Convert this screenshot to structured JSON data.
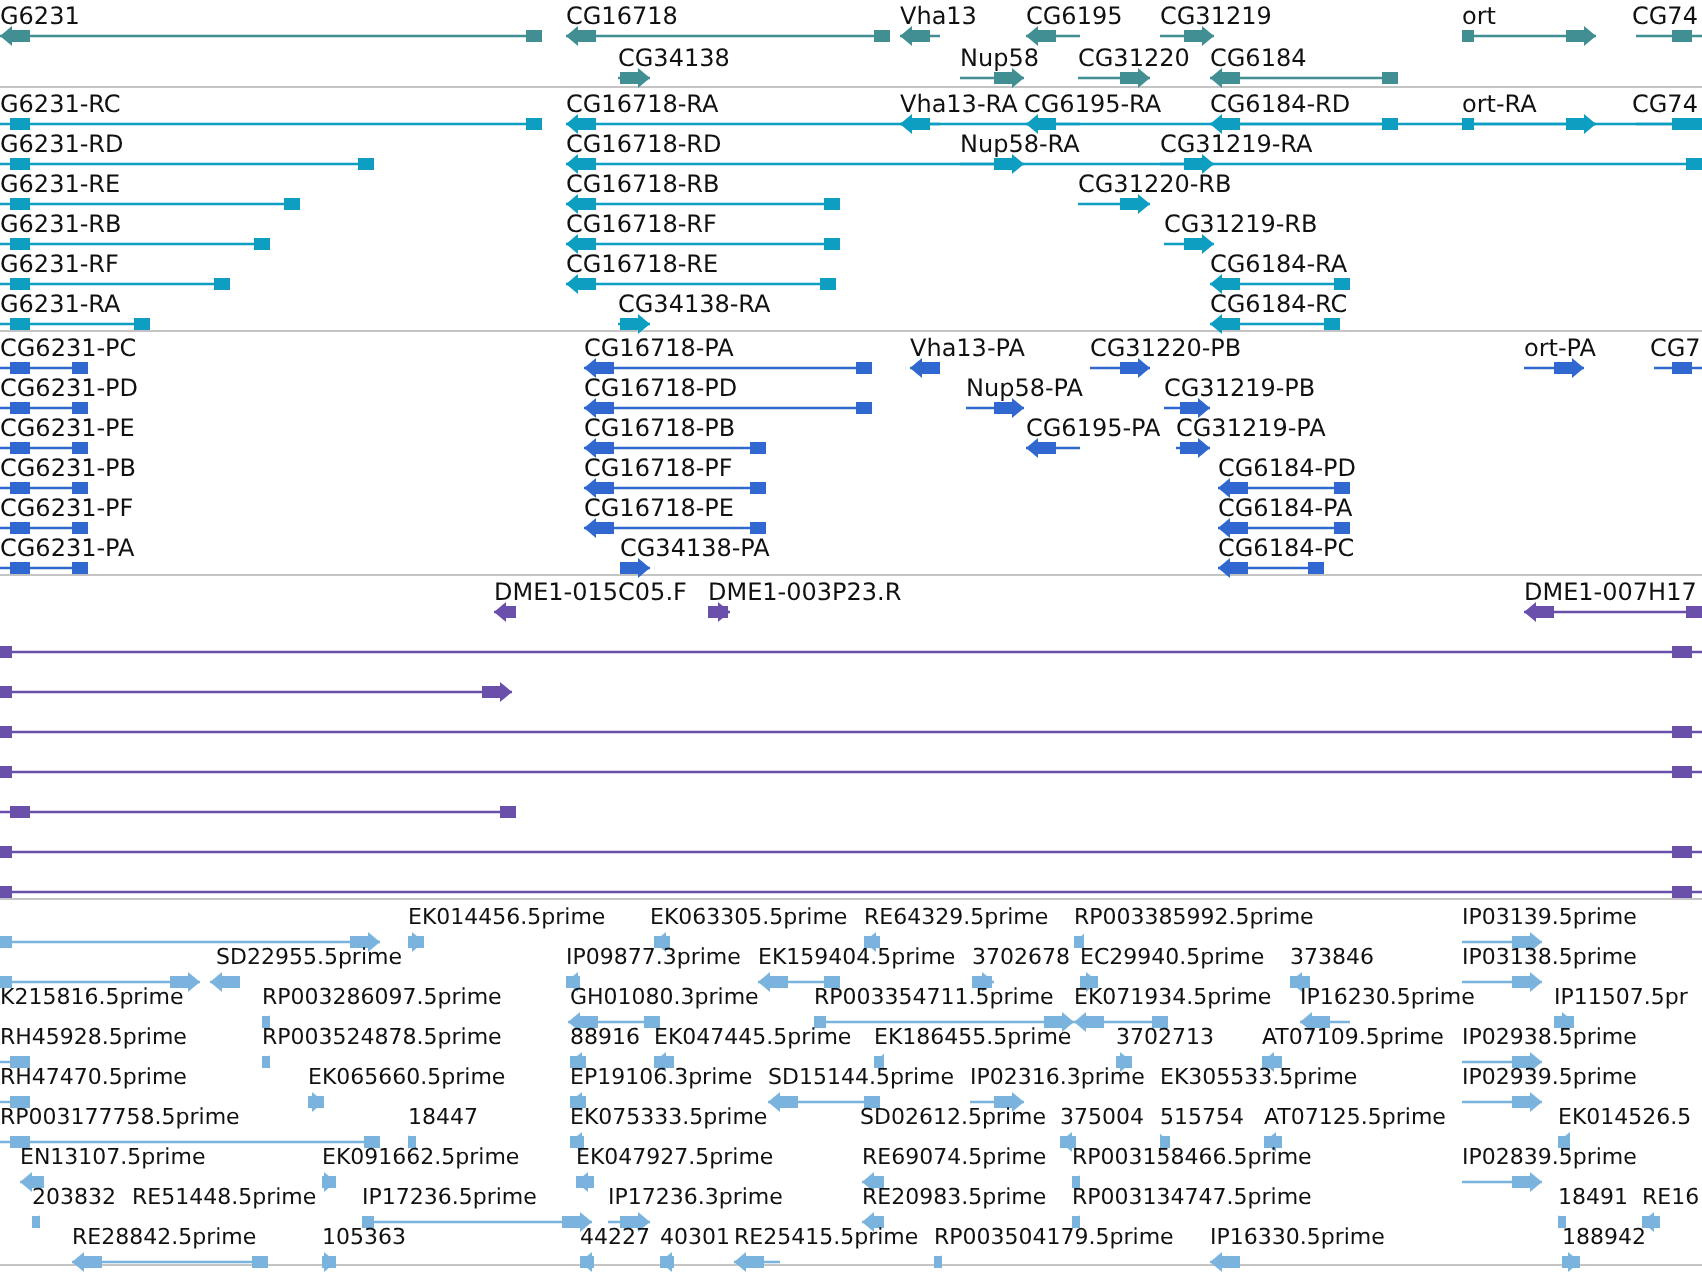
{
  "tracks": [
    {
      "kind": "gene",
      "features": [
        {
          "label": "G6231",
          "reverse": true
        },
        {
          "label": "CG16718",
          "reverse": true
        },
        {
          "label": "Vha13",
          "reverse": true
        },
        {
          "label": "CG6195",
          "reverse": true
        },
        {
          "label": "CG31219",
          "reverse": false
        },
        {
          "label": "ort",
          "reverse": false
        },
        {
          "label": "CG74",
          "reverse": false
        },
        {
          "label": "CG34138",
          "reverse": false
        },
        {
          "label": "Nup58",
          "reverse": false
        },
        {
          "label": "CG31220",
          "reverse": false
        },
        {
          "label": "CG6184",
          "reverse": true
        }
      ]
    },
    {
      "kind": "transcript",
      "features": [
        {
          "label": "G6231-RC",
          "reverse": true
        },
        {
          "label": "CG16718-RA",
          "reverse": true
        },
        {
          "label": "Vha13-RA",
          "reverse": true
        },
        {
          "label": "CG6195-RA",
          "reverse": true
        },
        {
          "label": "CG6184-RD",
          "reverse": true
        },
        {
          "label": "ort-RA",
          "reverse": false
        },
        {
          "label": "CG74",
          "reverse": false
        },
        {
          "label": "G6231-RD",
          "reverse": true
        },
        {
          "label": "CG16718-RD",
          "reverse": true
        },
        {
          "label": "Nup58-RA",
          "reverse": false
        },
        {
          "label": "CG31219-RA",
          "reverse": false
        },
        {
          "label": "G6231-RE",
          "reverse": true
        },
        {
          "label": "CG16718-RB",
          "reverse": true
        },
        {
          "label": "CG31220-RB",
          "reverse": false
        },
        {
          "label": "G6231-RB",
          "reverse": true
        },
        {
          "label": "CG16718-RF",
          "reverse": true
        },
        {
          "label": "CG31219-RB",
          "reverse": false
        },
        {
          "label": "G6231-RF",
          "reverse": true
        },
        {
          "label": "CG16718-RE",
          "reverse": true
        },
        {
          "label": "CG6184-RA",
          "reverse": true
        },
        {
          "label": "G6231-RA",
          "reverse": true
        },
        {
          "label": "CG34138-RA",
          "reverse": false
        },
        {
          "label": "CG6184-RC",
          "reverse": true
        }
      ]
    },
    {
      "kind": "protein",
      "features": [
        {
          "label": "CG6231-PC",
          "reverse": true
        },
        {
          "label": "CG16718-PA",
          "reverse": true
        },
        {
          "label": "Vha13-PA",
          "reverse": true
        },
        {
          "label": "CG31220-PB",
          "reverse": false
        },
        {
          "label": "ort-PA",
          "reverse": false
        },
        {
          "label": "CG7",
          "reverse": false
        },
        {
          "label": "CG6231-PD",
          "reverse": true
        },
        {
          "label": "CG16718-PD",
          "reverse": true
        },
        {
          "label": "Nup58-PA",
          "reverse": false
        },
        {
          "label": "CG31219-PB",
          "reverse": false
        },
        {
          "label": "CG6231-PE",
          "reverse": true
        },
        {
          "label": "CG16718-PB",
          "reverse": true
        },
        {
          "label": "CG6195-PA",
          "reverse": true
        },
        {
          "label": "CG31219-PA",
          "reverse": false
        },
        {
          "label": "CG6231-PB",
          "reverse": true
        },
        {
          "label": "CG16718-PF",
          "reverse": true
        },
        {
          "label": "CG6184-PD",
          "reverse": true
        },
        {
          "label": "CG6231-PF",
          "reverse": true
        },
        {
          "label": "CG16718-PE",
          "reverse": true
        },
        {
          "label": "CG6184-PA",
          "reverse": true
        },
        {
          "label": "CG6231-PA",
          "reverse": true
        },
        {
          "label": "CG34138-PA",
          "reverse": false
        },
        {
          "label": "CG6184-PC",
          "reverse": true
        }
      ]
    },
    {
      "kind": "clone",
      "features": [
        {
          "label": "DME1-015C05.F",
          "reverse": true
        },
        {
          "label": "DME1-003P23.R",
          "reverse": false
        },
        {
          "label": "DME1-007H17",
          "reverse": true
        },
        {
          "reverse": false
        },
        {
          "reverse": false
        },
        {
          "reverse": false
        },
        {
          "reverse": false
        },
        {
          "reverse": true
        },
        {
          "reverse": false
        },
        {
          "reverse": false
        }
      ]
    },
    {
      "kind": "est",
      "features": [
        {
          "reverse": false
        },
        {
          "label": "EK014456.5prime",
          "reverse": false
        },
        {
          "label": "EK063305.5prime",
          "reverse": true
        },
        {
          "label": "RE64329.5prime",
          "reverse": true
        },
        {
          "label": "RP003385992.5prime",
          "reverse": true
        },
        {
          "label": "IP03139.5prime",
          "reverse": false
        },
        {
          "reverse": false
        },
        {
          "label": "SD22955.5prime",
          "reverse": true
        },
        {
          "label": "IP09877.3prime",
          "reverse": true
        },
        {
          "label": "EK159404.5prime",
          "reverse": true
        },
        {
          "label": "3702678",
          "reverse": false
        },
        {
          "label": "EC29940.5prime",
          "reverse": false
        },
        {
          "label": "373846",
          "reverse": true
        },
        {
          "label": "IP03138.5prime",
          "reverse": false
        },
        {
          "label": "K215816.5prime"
        },
        {
          "label": "RP003286097.5prime",
          "reverse": true
        },
        {
          "label": "GH01080.3prime",
          "reverse": true
        },
        {
          "label": "RP003354711.5prime",
          "reverse": false
        },
        {
          "label": "EK071934.5prime",
          "reverse": true
        },
        {
          "label": "IP16230.5prime",
          "reverse": true
        },
        {
          "label": "IP11507.5pr",
          "reverse": false
        },
        {
          "label": "RH45928.5prime",
          "reverse": true
        },
        {
          "label": "RP003524878.5prime",
          "reverse": true
        },
        {
          "label": "88916",
          "reverse": true
        },
        {
          "label": "EK047445.5prime",
          "reverse": true
        },
        {
          "label": "EK186455.5prime",
          "reverse": true
        },
        {
          "label": "3702713",
          "reverse": false
        },
        {
          "label": "AT07109.5prime",
          "reverse": true
        },
        {
          "label": "IP02938.5prime",
          "reverse": false
        },
        {
          "label": "RH47470.5prime",
          "reverse": true
        },
        {
          "label": "EK065660.5prime",
          "reverse": false
        },
        {
          "label": "EP19106.3prime",
          "reverse": true
        },
        {
          "label": "SD15144.5prime",
          "reverse": true
        },
        {
          "label": "IP02316.3prime",
          "reverse": false
        },
        {
          "label": "EK305533.5prime"
        },
        {
          "label": "IP02939.5prime",
          "reverse": false
        },
        {
          "label": "RP003177758.5prime",
          "reverse": true
        },
        {
          "label": "18447",
          "reverse": false
        },
        {
          "label": "EK075333.5prime",
          "reverse": true
        },
        {
          "label": "SD02612.5prime"
        },
        {
          "label": "375004",
          "reverse": true
        },
        {
          "label": "515754",
          "reverse": false
        },
        {
          "label": "AT07125.5prime",
          "reverse": true
        },
        {
          "label": "EK014526.5",
          "reverse": true
        },
        {
          "label": "EN13107.5prime",
          "reverse": true
        },
        {
          "label": "EK091662.5prime",
          "reverse": false
        },
        {
          "label": "EK047927.5prime",
          "reverse": true
        },
        {
          "label": "RE69074.5prime",
          "reverse": true
        },
        {
          "label": "RP003158466.5prime",
          "reverse": true
        },
        {
          "label": "IP02839.5prime",
          "reverse": false
        },
        {
          "label": "203832",
          "reverse": true
        },
        {
          "label": "RE51448.5prime"
        },
        {
          "label": "IP17236.5prime",
          "reverse": false
        },
        {
          "label": "IP17236.3prime",
          "reverse": false
        },
        {
          "label": "RE20983.5prime",
          "reverse": true
        },
        {
          "label": "RP003134747.5prime",
          "reverse": true
        },
        {
          "label": "18491",
          "reverse": false
        },
        {
          "label": "RE16",
          "reverse": true
        },
        {
          "label": "RE28842.5prime",
          "reverse": true
        },
        {
          "label": "105363",
          "reverse": false
        },
        {
          "label": "44227",
          "reverse": true
        },
        {
          "label": "40301",
          "reverse": true
        },
        {
          "label": "RE25415.5prime",
          "reverse": true
        },
        {
          "label": "RP003504179.5prime",
          "reverse": true
        },
        {
          "label": "IP16330.5prime",
          "reverse": true
        },
        {
          "label": "188942",
          "reverse": false
        }
      ]
    }
  ]
}
